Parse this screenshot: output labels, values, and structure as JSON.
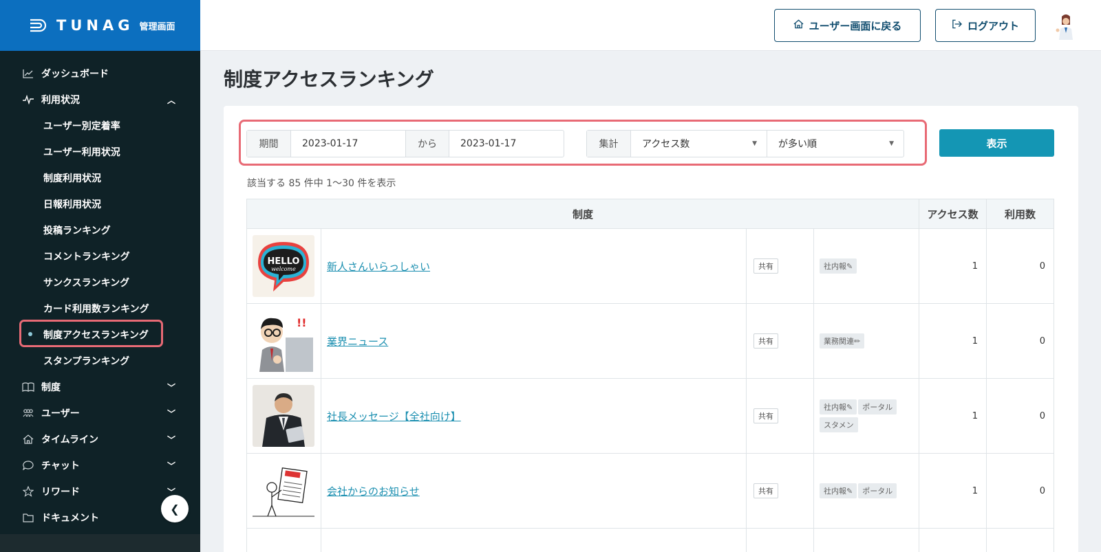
{
  "brand": {
    "name": "TUNAG",
    "sub": "管理画面"
  },
  "sidebar": {
    "items": [
      {
        "label": "ダッシュボード",
        "icon": "chart-icon"
      },
      {
        "label": "利用状況",
        "icon": "pulse-icon",
        "expanded": true
      },
      {
        "label": "制度",
        "icon": "book-icon"
      },
      {
        "label": "ユーザー",
        "icon": "users-icon"
      },
      {
        "label": "タイムライン",
        "icon": "home-icon"
      },
      {
        "label": "チャット",
        "icon": "chat-icon"
      },
      {
        "label": "リワード",
        "icon": "star-icon"
      },
      {
        "label": "ドキュメント",
        "icon": "folder-icon"
      }
    ],
    "sub_items": [
      "ユーザー別定着率",
      "ユーザー利用状況",
      "制度利用状況",
      "日報利用状況",
      "投稿ランキング",
      "コメントランキング",
      "サンクスランキング",
      "カード利用数ランキング",
      "制度アクセスランキング",
      "スタンプランキング"
    ],
    "active_sub": "制度アクセスランキング",
    "collapse_icon": "chevron-left-icon"
  },
  "header": {
    "user_button": "ユーザー画面に戻る",
    "logout_button": "ログアウト"
  },
  "page": {
    "title": "制度アクセスランキング"
  },
  "filter": {
    "period_label": "期間",
    "from_date": "2023-01-17",
    "from_word": "から",
    "to_date": "2023-01-17",
    "aggregate_label": "集計",
    "aggregate_value": "アクセス数",
    "order_value": "が多い順",
    "show_button": "表示"
  },
  "results": {
    "summary": "該当する 85 件中 1〜30 件を表示"
  },
  "table": {
    "headers": {
      "system": "制度",
      "access": "アクセス数",
      "usage": "利用数"
    },
    "rows": [
      {
        "title": "新人さんいらっしゃい",
        "share": "共有",
        "tags": [
          "社内報✎"
        ],
        "access": "1",
        "usage": "0",
        "thumb": "hello-welcome"
      },
      {
        "title": "業界ニュース",
        "share": "共有",
        "tags": [
          "業務関連✏"
        ],
        "access": "1",
        "usage": "0",
        "thumb": "businessman-cartoon"
      },
      {
        "title": "社長メッセージ【全社向け】",
        "share": "共有",
        "tags": [
          "社内報✎",
          "ポータル",
          "スタメン"
        ],
        "access": "1",
        "usage": "0",
        "thumb": "ceo-photo"
      },
      {
        "title": "会社からのお知らせ",
        "share": "共有",
        "tags": [
          "社内報✎",
          "ポータル"
        ],
        "access": "1",
        "usage": "0",
        "thumb": "news-doodle"
      }
    ]
  }
}
